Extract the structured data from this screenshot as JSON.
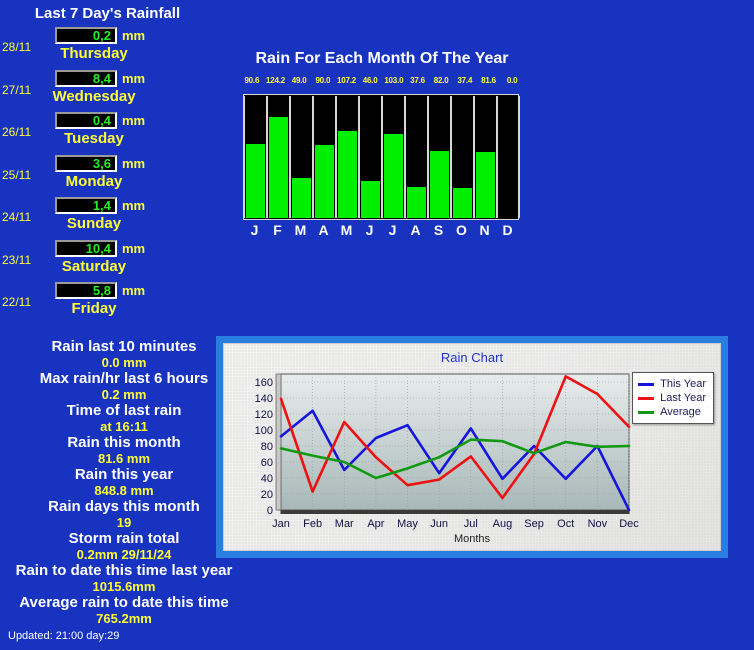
{
  "page_title": "Last 7 Day's Rainfall",
  "colors": {
    "background": "#1733c0",
    "label_white": "#ffffff",
    "value_yellow": "#ffff33",
    "lcd_green": "#22ee22",
    "bar_green": "#00ee00",
    "this_year": "#1515dd",
    "last_year": "#ee1111",
    "average": "#119911"
  },
  "days": [
    {
      "date": "28/11",
      "value": "0,2",
      "unit": "mm",
      "name": "Thursday"
    },
    {
      "date": "27/11",
      "value": "8,4",
      "unit": "mm",
      "name": "Wednesday"
    },
    {
      "date": "26/11",
      "value": "0,4",
      "unit": "mm",
      "name": "Tuesday"
    },
    {
      "date": "25/11",
      "value": "3,6",
      "unit": "mm",
      "name": "Monday"
    },
    {
      "date": "24/11",
      "value": "1,4",
      "unit": "mm",
      "name": "Sunday"
    },
    {
      "date": "23/11",
      "value": "10,4",
      "unit": "mm",
      "name": "Saturday"
    },
    {
      "date": "22/11",
      "value": "5,8",
      "unit": "mm",
      "name": "Friday"
    }
  ],
  "stats": [
    {
      "label": "Rain last 10 minutes",
      "value": "0.0 mm"
    },
    {
      "label": "Max rain/hr last 6 hours",
      "value": "0.2 mm"
    },
    {
      "label": "Time of last rain",
      "value": "at 16:11"
    },
    {
      "label": "Rain this month",
      "value": "81.6 mm"
    },
    {
      "label": "Rain this year",
      "value": "848.8 mm"
    },
    {
      "label": "Rain days this month",
      "value": "19"
    },
    {
      "label": "Storm rain total",
      "value": "0.2mm 29/11/24"
    },
    {
      "label": "Rain to date this time last year",
      "value": "1015.6mm"
    },
    {
      "label": "Average rain to date this time",
      "value": "765.2mm"
    }
  ],
  "updated": "Updated: 21:00 day:29",
  "chart_data": [
    {
      "type": "bar",
      "title": "Rain For Each Month Of The Year",
      "categories": [
        "J",
        "F",
        "M",
        "A",
        "M",
        "J",
        "J",
        "A",
        "S",
        "O",
        "N",
        "D"
      ],
      "values": [
        90.6,
        124.2,
        49.0,
        90.0,
        107.2,
        46.0,
        103.0,
        37.6,
        82.0,
        37.4,
        81.6,
        0.0
      ],
      "value_labels": [
        "90.6",
        "124.2",
        "49.0",
        "90.0",
        "107.2",
        "46.0",
        "103.0",
        "37.6",
        "82.0",
        "37.4",
        "81.6",
        "0.0"
      ],
      "xlabel": "",
      "ylabel": "",
      "ylim": [
        0,
        150
      ],
      "grid": false
    },
    {
      "type": "line",
      "title": "Rain Chart",
      "categories": [
        "Jan",
        "Feb",
        "Mar",
        "Apr",
        "May",
        "Jun",
        "Jul",
        "Aug",
        "Sep",
        "Oct",
        "Nov",
        "Dec"
      ],
      "series": [
        {
          "name": "This Year",
          "color": "#1515dd",
          "values": [
            92,
            124,
            50,
            90,
            106,
            46,
            102,
            39,
            80,
            39,
            80,
            0
          ]
        },
        {
          "name": "Last Year",
          "color": "#ee1111",
          "values": [
            139,
            23,
            110,
            66,
            31,
            38,
            67,
            15,
            70,
            167,
            145,
            104
          ]
        },
        {
          "name": "Average",
          "color": "#119911",
          "values": [
            77,
            68,
            60,
            40,
            52,
            66,
            88,
            86,
            71,
            85,
            79,
            80
          ]
        }
      ],
      "xlabel": "Months",
      "ylabel": "",
      "ylim": [
        0,
        170
      ],
      "yticks": [
        0,
        20,
        40,
        60,
        80,
        100,
        120,
        140,
        160
      ],
      "grid": true,
      "legend_position": "top-right"
    }
  ]
}
